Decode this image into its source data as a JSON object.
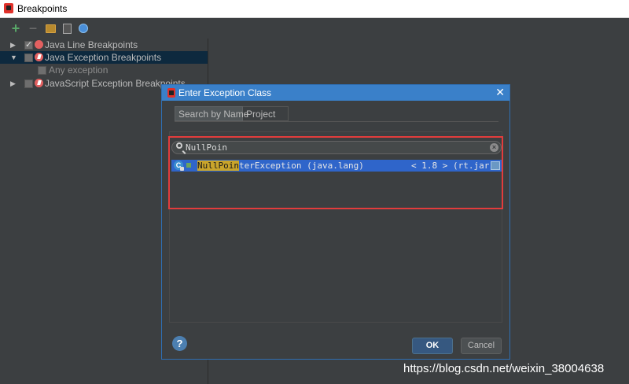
{
  "window": {
    "title": "Breakpoints"
  },
  "tree": {
    "items": [
      {
        "label": "Java Line Breakpoints",
        "expanded": false,
        "checked": true
      },
      {
        "label": "Java Exception Breakpoints",
        "expanded": true,
        "checked": false,
        "selected": true
      },
      {
        "label": "Any exception",
        "checked": false
      },
      {
        "label": "JavaScript Exception Breakpoints",
        "expanded": false,
        "checked": false
      }
    ]
  },
  "dialog": {
    "title": "Enter Exception Class",
    "tabs": [
      {
        "label": "Search by Name",
        "active": true
      },
      {
        "label": "Project",
        "active": false
      }
    ],
    "search": {
      "value": "NullPoin"
    },
    "result": {
      "match": "NullPoin",
      "rest": "terException (java.lang)",
      "version": "< 1.8 > (rt.jar)"
    },
    "help_label": "?",
    "ok_label": "OK",
    "cancel_label": "Cancel"
  },
  "watermark": "https://blog.csdn.net/weixin_38004638",
  "colors": {
    "accent": "#3a80c9",
    "selection": "#2f65ca",
    "highlight_box": "#e23c3c",
    "match": "#c9a52b"
  }
}
